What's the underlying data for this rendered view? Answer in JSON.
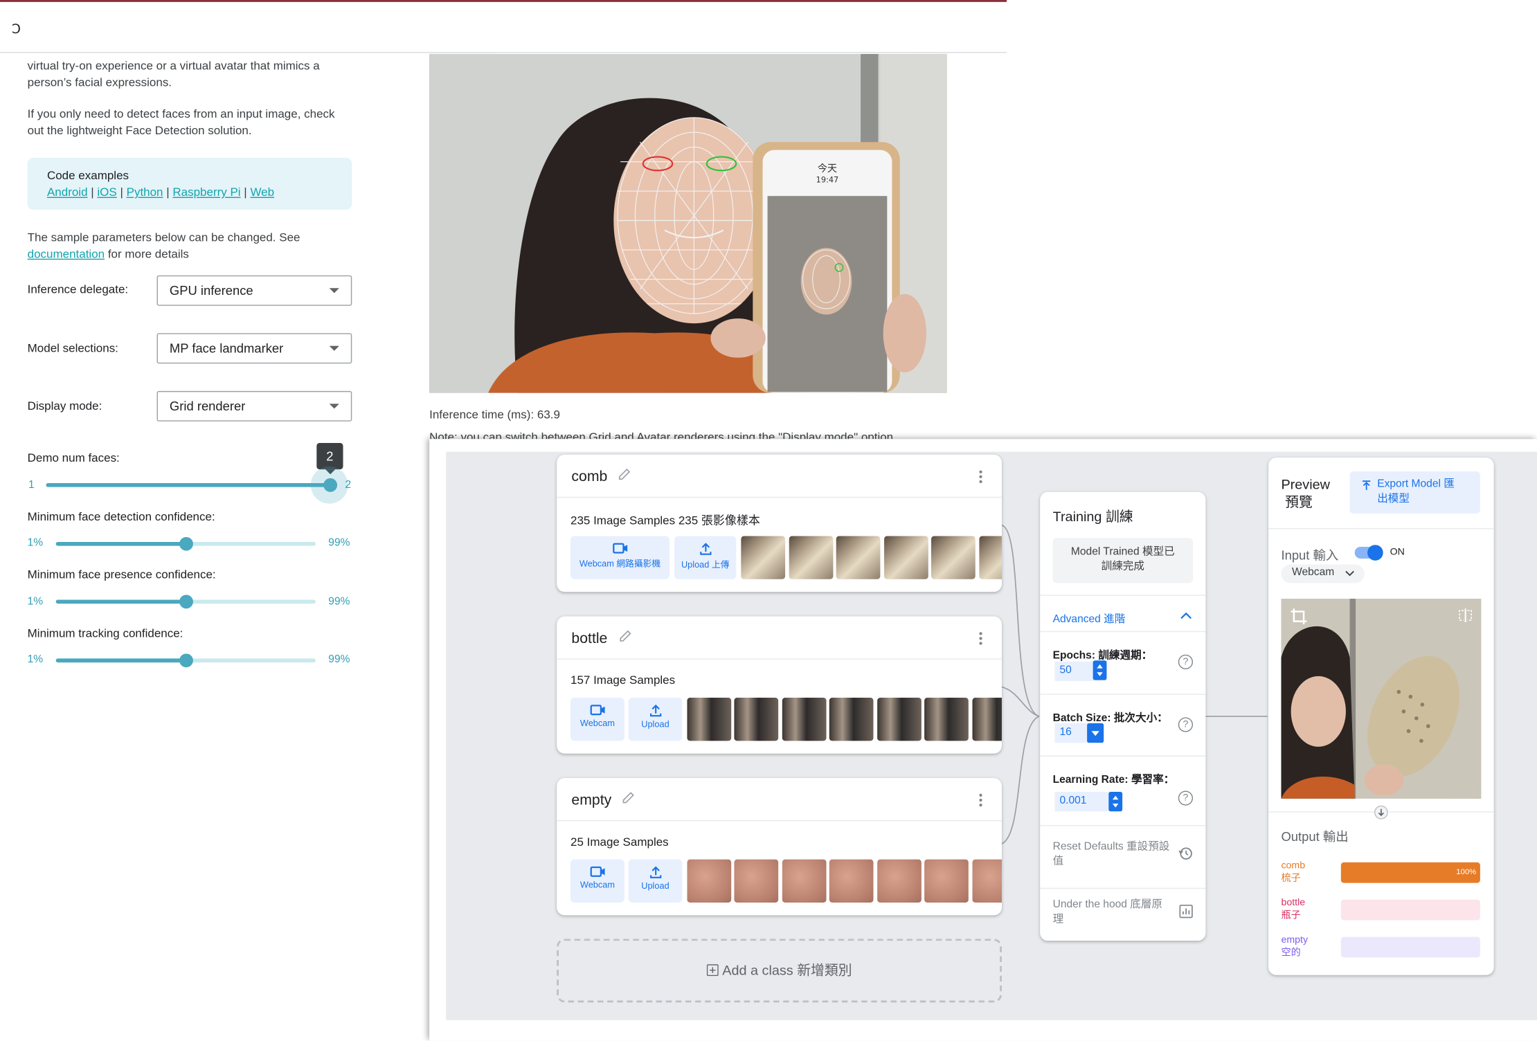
{
  "doc": {
    "intro_line1": "virtual try-on experience or a virtual avatar that mimics a",
    "intro_line2": "person’s facial expressions.",
    "detect_line1": "If you only need to detect faces from an input image, check",
    "detect_line2": "out the lightweight Face Detection solution.",
    "code_examples": {
      "title": "Code examples",
      "links": [
        "Android",
        "iOS",
        "Python",
        "Raspberry Pi",
        "Web"
      ],
      "separator": " | "
    },
    "params_line1": "The sample parameters below can be changed. See",
    "params_link": "documentation",
    "params_line2_rest": " for more details",
    "inference_delegate": {
      "label": "Inference delegate:",
      "value": "GPU inference"
    },
    "model_selections": {
      "label": "Model selections:",
      "value": "MP face landmarker"
    },
    "display_mode": {
      "label": "Display mode:",
      "value": "Grid renderer"
    },
    "num_faces": {
      "label": "Demo num faces:",
      "min": "1",
      "max": "2",
      "value": 2,
      "tooltip": "2"
    },
    "min_detection": {
      "label": "Minimum face detection confidence:",
      "min": "1%",
      "max": "99%",
      "value": 0.5
    },
    "min_presence": {
      "label": "Minimum face presence confidence:",
      "min": "1%",
      "max": "99%",
      "value": 0.5
    },
    "min_tracking": {
      "label": "Minimum tracking confidence:",
      "min": "1%",
      "max": "99%",
      "value": 0.5
    },
    "inference_time": "Inference time (ms): 63.9",
    "note": "Note: you can switch between Grid and Avatar renderers using the \"Display mode\" option"
  },
  "phone_screen": {
    "title": "今天",
    "time": "19:47"
  },
  "classes": [
    {
      "name": "comb",
      "samples": "235 Image Samples  235 張影像樣本",
      "webcam": "Webcam  網路攝影機",
      "upload": "Upload  上傳"
    },
    {
      "name": "bottle",
      "samples": "157 Image Samples",
      "webcam": "Webcam",
      "upload": "Upload"
    },
    {
      "name": "empty",
      "samples": "25 Image Samples",
      "webcam": "Webcam",
      "upload": "Upload"
    }
  ],
  "add_class": "Add a class  新增類別",
  "training": {
    "title": "Training  訓練",
    "button_line1": "Model Trained  模型已",
    "button_line2": "訓練完成",
    "advanced": "Advanced  進階",
    "epochs": {
      "label": "Epochs:  訓練週期：",
      "value": "50"
    },
    "batch": {
      "label": "Batch Size:  批次大小：",
      "value": "16"
    },
    "lr": {
      "label": "Learning Rate:  學習率：",
      "value": "0.001"
    },
    "help": "?",
    "reset_line1": "Reset Defaults  重設預設",
    "reset_line2": "值",
    "hood_line1": "Under the hood  底層原",
    "hood_line2": "理"
  },
  "preview": {
    "title_line1": "Preview",
    "title_line2": "預覽",
    "export_line1": "Export Model  匯",
    "export_line2": "出模型",
    "input": "Input  輸入",
    "on": "ON",
    "webcam": "Webcam",
    "output": "Output  輸出",
    "results": [
      {
        "en": "comb",
        "zh": "梳子",
        "value": 1.0,
        "pct": "100%",
        "color": "#e67c28",
        "bg": "#fdebdc"
      },
      {
        "en": "bottle",
        "zh": "瓶子",
        "value": 0.0,
        "pct": "",
        "color": "#d93064",
        "bg": "#fce4ea"
      },
      {
        "en": "empty",
        "zh": "空的",
        "value": 0.0,
        "pct": "",
        "color": "#7b5cf0",
        "bg": "#ebe8fd"
      }
    ]
  },
  "colors": {
    "accent_teal": "#4aa8bf",
    "link_teal": "#12a4af",
    "tm_blue": "#1a73e8",
    "top_rule": "#8b2e3b"
  }
}
